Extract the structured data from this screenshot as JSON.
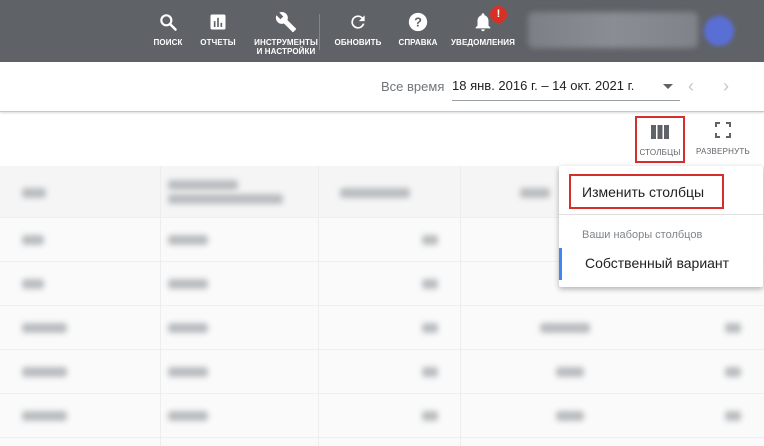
{
  "topbar": {
    "items": [
      {
        "label": "ПОИСК",
        "icon": "search-icon"
      },
      {
        "label": "ОТЧЕТЫ",
        "icon": "bar-chart-icon"
      },
      {
        "label": "ИНСТРУМЕНТЫ И НАСТРОЙКИ",
        "icon": "wrench-icon"
      },
      {
        "label": "ОБНОВИТЬ",
        "icon": "refresh-icon"
      },
      {
        "label": "СПРАВКА",
        "icon": "help-icon"
      },
      {
        "label": "УВЕДОМЛЕНИЯ",
        "icon": "bell-icon",
        "badge": "!"
      }
    ],
    "colors": {
      "bar": "#5f6368",
      "badge": "#d93025"
    }
  },
  "datebar": {
    "label": "Все время",
    "range": "18 янв. 2016 г. – 14 окт. 2021 г.",
    "prev": "‹",
    "next": "›"
  },
  "toolbar": {
    "columns_label": "СТОЛБЦЫ",
    "expand_label": "РАЗВЕРНУТЬ",
    "highlight_color": "#d32f2f"
  },
  "dropdown": {
    "edit_columns": "Изменить столбцы",
    "section_title": "Ваши наборы столбцов",
    "custom_set": "Собственный вариант",
    "accent": "#4285f4"
  }
}
